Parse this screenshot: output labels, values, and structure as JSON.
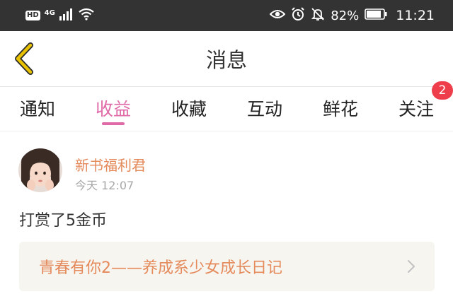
{
  "status_bar": {
    "hd_label": "HD",
    "network_type": "4G",
    "battery_percent": "82%",
    "time": "11:21",
    "icons": [
      "signal-icon",
      "wifi-icon",
      "eye-icon",
      "alarm-icon",
      "mute-bell-icon",
      "battery-icon"
    ]
  },
  "header": {
    "title": "消息",
    "back_icon": "back-chevron-icon",
    "accent_color": "#e8c200"
  },
  "tabs": {
    "items": [
      {
        "label": "通知"
      },
      {
        "label": "收益"
      },
      {
        "label": "收藏"
      },
      {
        "label": "互动"
      },
      {
        "label": "鲜花"
      },
      {
        "label": "关注"
      }
    ],
    "active_index": 1,
    "active_color": "#e069a7",
    "badge_count": "2",
    "badge_color": "#ee3d4b"
  },
  "message": {
    "sender": "新书福利君",
    "time": "今天 12:07",
    "text": "打赏了5金币",
    "book_title": "青春有你2——养成系少女成长日记",
    "accent_color": "#e48a5b"
  }
}
